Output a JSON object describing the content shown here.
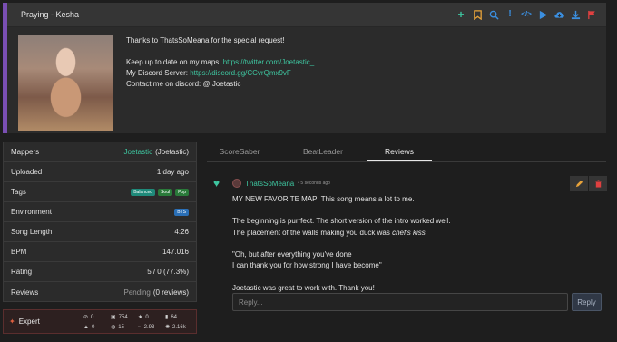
{
  "map": {
    "title": "Praying - Kesha",
    "description_lines": [
      "Thanks to ThatsSoMeana for the special request!",
      "",
      "Keep up to date on my maps: ",
      "My Discord Server: ",
      "Contact me on discord: @ Joetastic"
    ],
    "twitter_link": "https://twitter.com/Joetastic_",
    "discord_link": "https://discord.gg/CCvrQmx9vF"
  },
  "toolbar": {
    "icons": [
      {
        "name": "plus-icon",
        "color": "#3ec6a0"
      },
      {
        "name": "bookmark-icon",
        "color": "#e8a33a"
      },
      {
        "name": "zoom-icon",
        "color": "#3b8fe0"
      },
      {
        "name": "exclamation-icon",
        "color": "#3b8fe0"
      },
      {
        "name": "code-icon",
        "color": "#3b8fe0"
      },
      {
        "name": "play-icon",
        "color": "#3b8fe0"
      },
      {
        "name": "cloud-download-icon",
        "color": "#3b8fe0"
      },
      {
        "name": "download-icon",
        "color": "#3b8fe0"
      },
      {
        "name": "flag-icon",
        "color": "#e04040"
      }
    ]
  },
  "info": {
    "mappers_label": "Mappers",
    "mapper_name": "Joetastic",
    "mapper_alias": "(Joetastic)",
    "uploaded_label": "Uploaded",
    "uploaded_value": "1 day ago",
    "tags_label": "Tags",
    "tags": [
      "Balanced",
      "Soul",
      "Pop"
    ],
    "environment_label": "Environment",
    "environment_value": "BTS",
    "song_length_label": "Song Length",
    "song_length_value": "4:26",
    "bpm_label": "BPM",
    "bpm_value": "147.016",
    "rating_label": "Rating",
    "rating_value": "5 / 0 (77.3%)",
    "reviews_label": "Reviews",
    "reviews_pending": "Pending",
    "reviews_count": "(0 reviews)"
  },
  "difficulty": {
    "name": "Expert",
    "stats": [
      {
        "icon": "error-icon",
        "value": "0"
      },
      {
        "icon": "notes-icon",
        "value": "754"
      },
      {
        "icon": "lights-icon",
        "value": "0"
      },
      {
        "icon": "bomb-icon",
        "value": "64"
      },
      {
        "icon": "warning-icon",
        "value": "0"
      },
      {
        "icon": "obstacles-icon",
        "value": "15"
      },
      {
        "icon": "nps-icon",
        "value": "2.93"
      },
      {
        "icon": "light-events-icon",
        "value": "2.16k"
      }
    ]
  },
  "tabs": [
    "ScoreSaber",
    "BeatLeader",
    "Reviews"
  ],
  "review": {
    "author": "ThatsSoMeana",
    "time_ago": "• 5 seconds ago",
    "line1": "MY NEW FAVORITE MAP! This song means a lot to me.",
    "line2": "The beginning is purrfect. The short version of the intro worked well.",
    "line3_prefix": "The placement of the walls making you duck was ",
    "line3_italic": "chef's kiss.",
    "line4": "\"Oh, but after everything you've done",
    "line5": "I can thank you for how strong I have become\"",
    "line6": "Joetastic was great to work with. Thank you!"
  },
  "reply": {
    "placeholder": "Reply...",
    "button_label": "Reply"
  }
}
